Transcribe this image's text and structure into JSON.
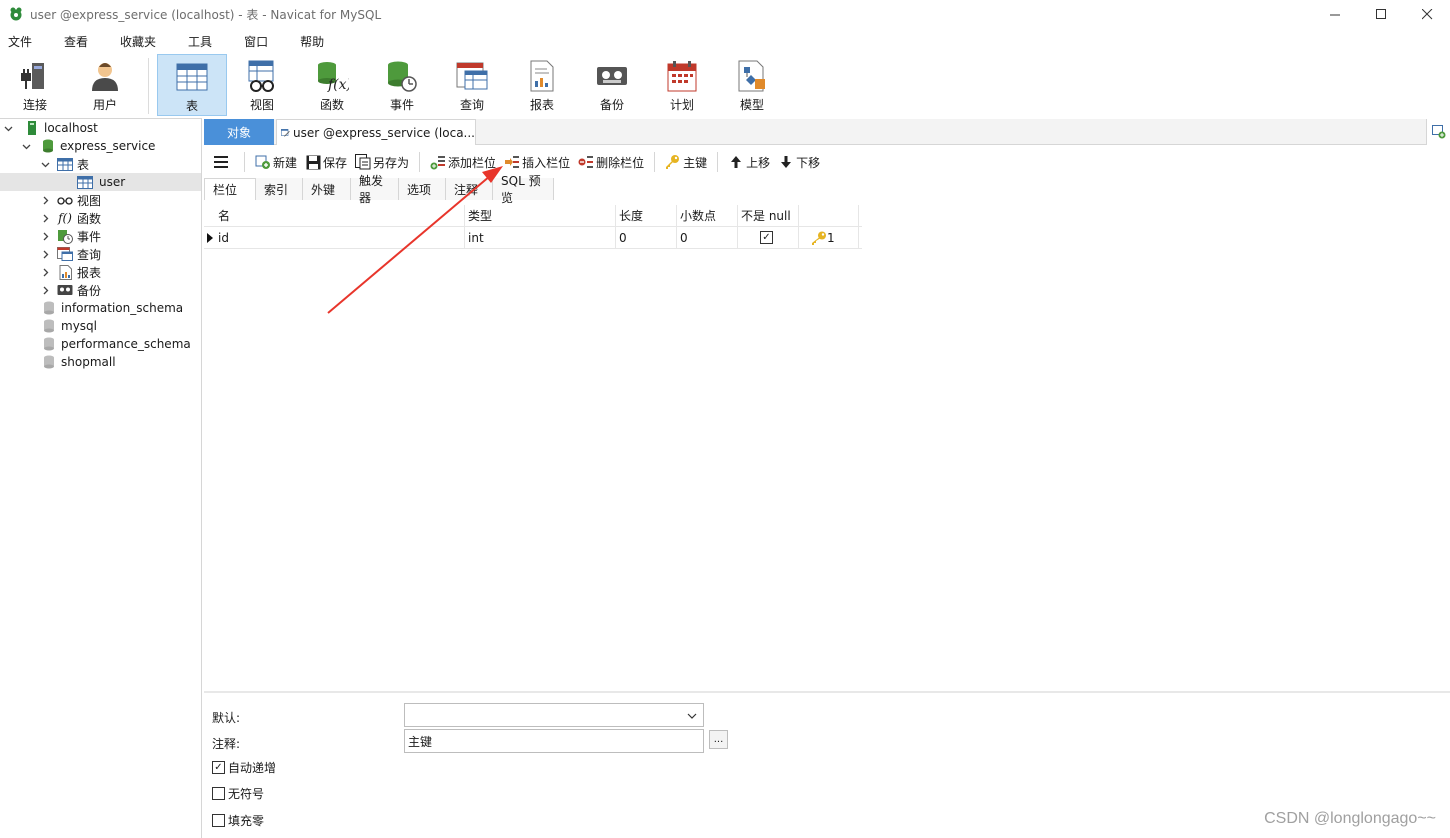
{
  "window": {
    "title": "user @express_service (localhost) - 表 - Navicat for MySQL",
    "minimize_icon": "minimize-icon",
    "maximize_icon": "maximize-icon",
    "close_icon": "close-icon"
  },
  "menu": [
    "文件",
    "查看",
    "收藏夹",
    "工具",
    "窗口",
    "帮助"
  ],
  "toolbar": [
    {
      "label": "连接",
      "icon": "connection-icon"
    },
    {
      "label": "用户",
      "icon": "user-icon"
    },
    {
      "label": "表",
      "icon": "table-icon",
      "active": true
    },
    {
      "label": "视图",
      "icon": "view-icon"
    },
    {
      "label": "函数",
      "icon": "function-icon"
    },
    {
      "label": "事件",
      "icon": "event-icon"
    },
    {
      "label": "查询",
      "icon": "query-icon"
    },
    {
      "label": "报表",
      "icon": "report-icon"
    },
    {
      "label": "备份",
      "icon": "backup-icon"
    },
    {
      "label": "计划",
      "icon": "schedule-icon"
    },
    {
      "label": "模型",
      "icon": "model-icon"
    }
  ],
  "sidebar": {
    "connection": "localhost",
    "database": "express_service",
    "tables_folder": "表",
    "selected_table": "user",
    "folders": [
      "视图",
      "函数",
      "事件",
      "查询",
      "报表",
      "备份"
    ],
    "other_databases": [
      "information_schema",
      "mysql",
      "performance_schema",
      "shopmall"
    ]
  },
  "tabs": {
    "objects": "对象",
    "document": "user @express_service (loca..."
  },
  "designer_toolbar": {
    "new": "新建",
    "save": "保存",
    "save_as": "另存为",
    "add_field": "添加栏位",
    "insert_field": "插入栏位",
    "delete_field": "删除栏位",
    "primary_key": "主键",
    "move_up": "上移",
    "move_down": "下移"
  },
  "subtabs": [
    "栏位",
    "索引",
    "外键",
    "触发器",
    "选项",
    "注释",
    "SQL 预览"
  ],
  "grid": {
    "columns": [
      "名",
      "类型",
      "长度",
      "小数点",
      "不是 null",
      ""
    ],
    "rows": [
      {
        "name": "id",
        "type": "int",
        "length": "0",
        "decimals": "0",
        "not_null": true,
        "key": "1"
      }
    ]
  },
  "properties": {
    "default_label": "默认:",
    "default_value": "",
    "comment_label": "注释:",
    "comment_value": "主键",
    "ellipsis": "...",
    "auto_increment_label": "自动递增",
    "auto_increment": true,
    "unsigned_label": "无符号",
    "unsigned": false,
    "zerofill_label": "填充零",
    "zerofill": false
  },
  "annotation": {
    "color": "#e8352b"
  },
  "watermark": "CSDN @longlongago~~"
}
